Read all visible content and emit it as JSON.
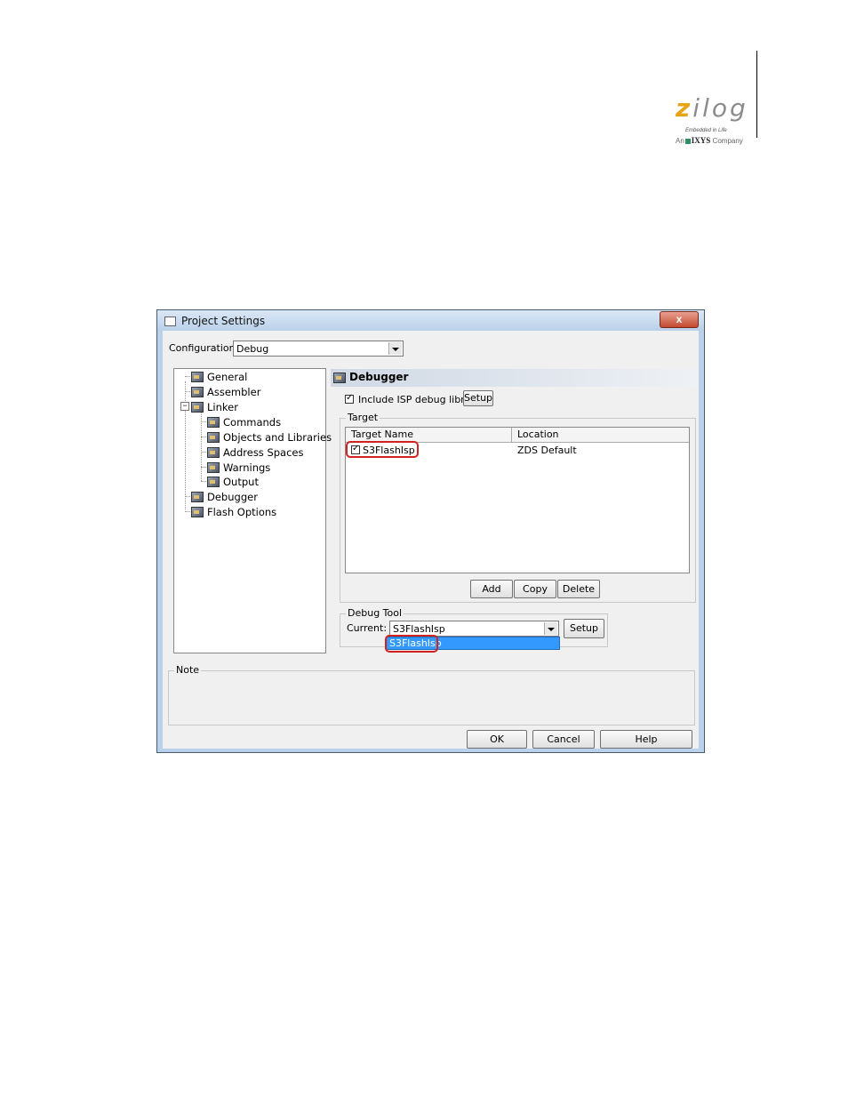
{
  "logo": {
    "word_z": "z",
    "word_rest": "ilog",
    "tagline": "Embedded in Life",
    "company_prefix": "An",
    "company_name": "IXYS",
    "company_suffix": "Company"
  },
  "dialog": {
    "title": "Project Settings",
    "close_label": "x",
    "configuration_label": "Configuration:",
    "configuration_value": "Debug",
    "tree": [
      "General",
      "Assembler",
      "Linker",
      "Commands",
      "Objects and Libraries",
      "Address Spaces",
      "Warnings",
      "Output",
      "Debugger",
      "Flash Options"
    ],
    "tree_expander": "−",
    "panel_title": "Debugger",
    "include_isp_label": "Include ISP debug library",
    "isp_setup_label": "Setup",
    "target_group_label": "Target",
    "columns": [
      "Target Name",
      "Location"
    ],
    "target_rows": [
      {
        "name": "S3FlashIsp",
        "location": "ZDS Default",
        "checked": true
      }
    ],
    "add_label": "Add",
    "copy_label": "Copy",
    "delete_label": "Delete",
    "debug_tool_group_label": "Debug Tool",
    "current_label": "Current:",
    "current_value": "S3FlashIsp",
    "dropdown_option": "S3FlashIsp",
    "debug_setup_label": "Setup",
    "note_label": "Note",
    "ok_label": "OK",
    "cancel_label": "Cancel",
    "help_label": "Help"
  }
}
